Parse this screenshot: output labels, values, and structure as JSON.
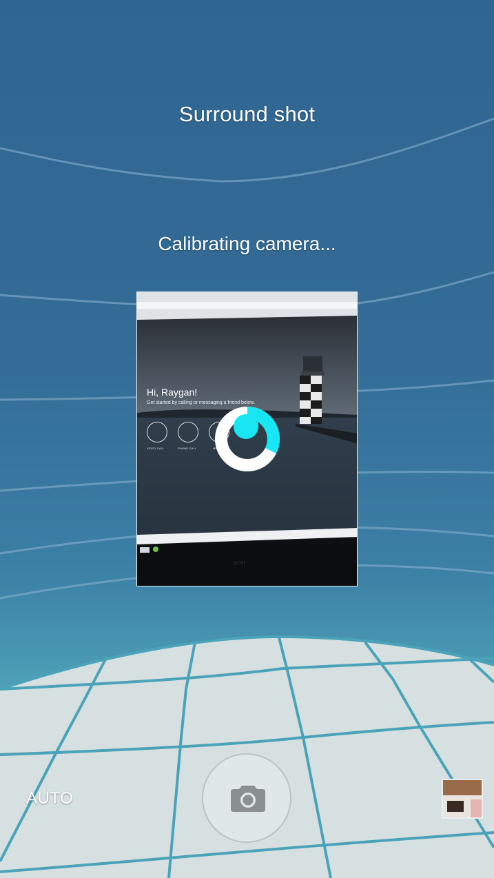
{
  "header": {
    "mode_title": "Surround shot",
    "status": "Calibrating camera..."
  },
  "preview": {
    "greeting": "Hi, Raygan!",
    "subtitle": "Get started by calling or messaging a friend below.",
    "actions": [
      {
        "label": "VIDEO CALL",
        "icon": "video-icon"
      },
      {
        "label": "PHONE CALL",
        "icon": "phone-icon"
      },
      {
        "label": "ME",
        "icon": "message-icon"
      }
    ]
  },
  "controls": {
    "flash_mode": "AUTO",
    "shutter_icon": "camera-icon",
    "gallery_icon": "gallery-thumbnail"
  },
  "colors": {
    "accent": "#18e6f2",
    "sky": "#336c97",
    "floor": "#d6e0e1",
    "grid_line": "#4aa3b8"
  }
}
